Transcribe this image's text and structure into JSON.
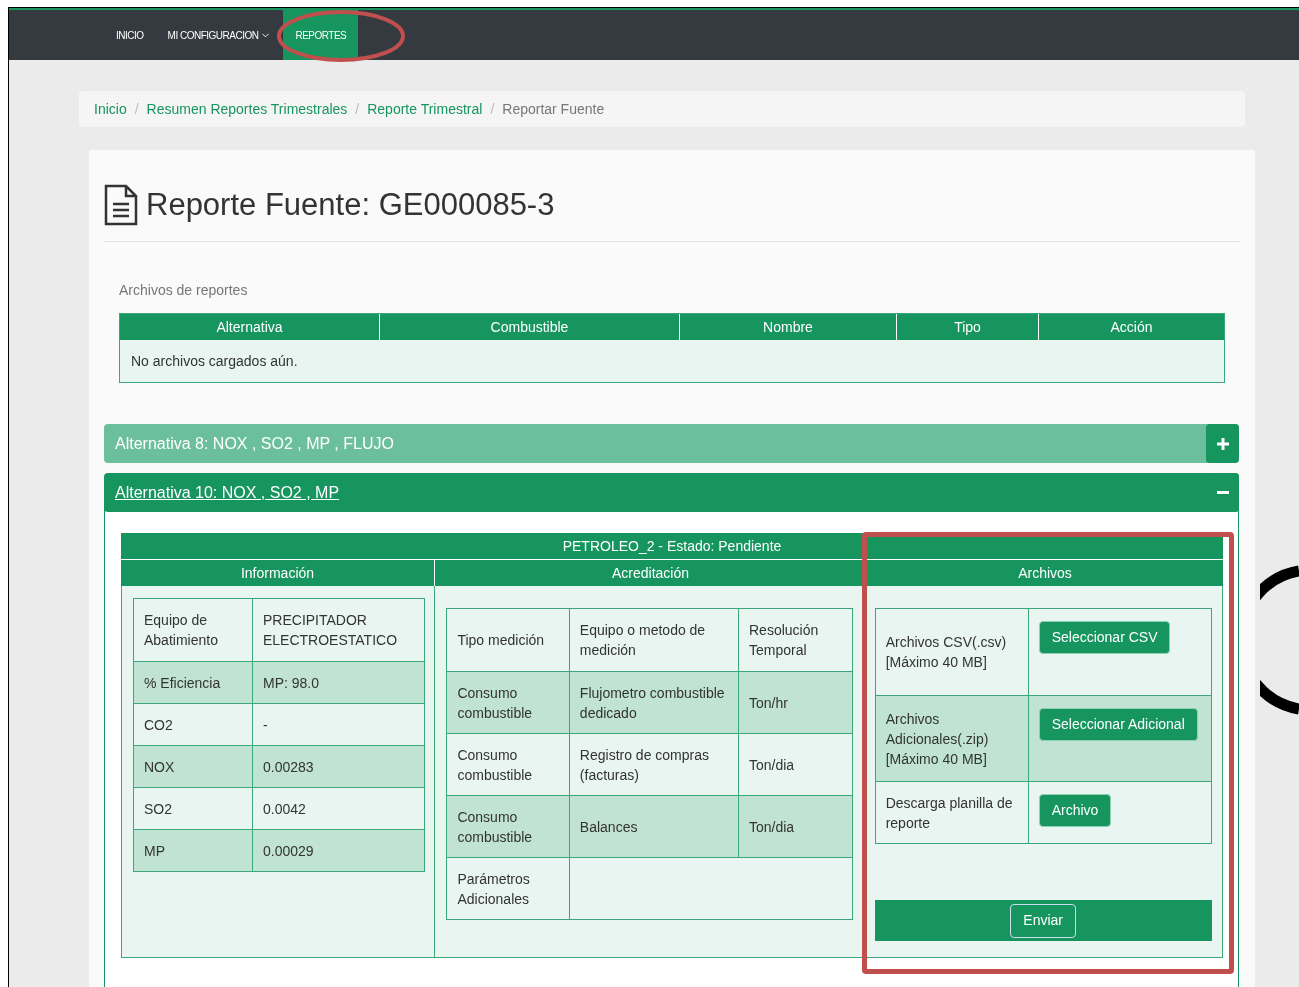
{
  "nav": {
    "items": [
      {
        "label": "INICIO",
        "kind": "link",
        "selected": false
      },
      {
        "label": "MI CONFIGURACION",
        "kind": "dropdown",
        "selected": false
      },
      {
        "label": "REPORTES",
        "kind": "link",
        "selected": true
      }
    ]
  },
  "breadcrumb": [
    {
      "label": "Inicio",
      "current": false
    },
    {
      "separator": "/",
      "label": "Resumen Reportes Trimestrales",
      "current": false
    },
    {
      "separator": "/",
      "label": "Reporte Trimestral",
      "current": false
    },
    {
      "separator": "/",
      "label": "Reportar Fuente",
      "current": true
    }
  ],
  "title": "Reporte Fuente: GE000085-3",
  "files_section": {
    "label": "Archivos de reportes",
    "columns": [
      "Alternativa",
      "Combustible",
      "Nombre",
      "Tipo",
      "Acción"
    ],
    "empty_message": "No archivos cargados aún."
  },
  "accordions": [
    {
      "title": "Alternativa 8: NOX , SO2 , MP , FLUJO",
      "expanded": false
    },
    {
      "title": "Alternativa 10: NOX , SO2 , MP",
      "expanded": true
    }
  ],
  "fuel_panel": {
    "title": "PETROLEO_2 - Estado: Pendiente",
    "info": {
      "heading": "Información",
      "rows": [
        [
          "Equipo de Abatimiento",
          "PRECIPITADOR ELECTROESTATICO"
        ],
        [
          "% Eficiencia",
          "MP: 98.0"
        ],
        [
          "CO2",
          "-"
        ],
        [
          "NOX",
          "0.00283"
        ],
        [
          "SO2",
          "0.0042"
        ],
        [
          "MP",
          "0.00029"
        ]
      ]
    },
    "accreditation": {
      "heading": "Acreditación",
      "rows": [
        [
          "Tipo medición",
          "Equipo o metodo de medición",
          "Resolución Temporal"
        ],
        [
          "Consumo combustible",
          "Flujometro combustible dedicado",
          "Ton/hr"
        ],
        [
          "Consumo combustible",
          "Registro de compras (facturas)",
          "Ton/dia"
        ],
        [
          "Consumo combustible",
          "Balances",
          "Ton/dia"
        ],
        [
          "Parámetros Adicionales"
        ]
      ]
    },
    "files": {
      "heading": "Archivos",
      "rows": [
        {
          "label": "Archivos CSV(.csv) [Máximo 40 MB]",
          "button": "Seleccionar CSV"
        },
        {
          "label": "Archivos Adicionales(.zip) [Máximo 40 MB]",
          "button": "Seleccionar Adicional"
        },
        {
          "label": "Descarga planilla de reporte",
          "button": "Archivo"
        }
      ],
      "submit": "Enviar"
    }
  }
}
